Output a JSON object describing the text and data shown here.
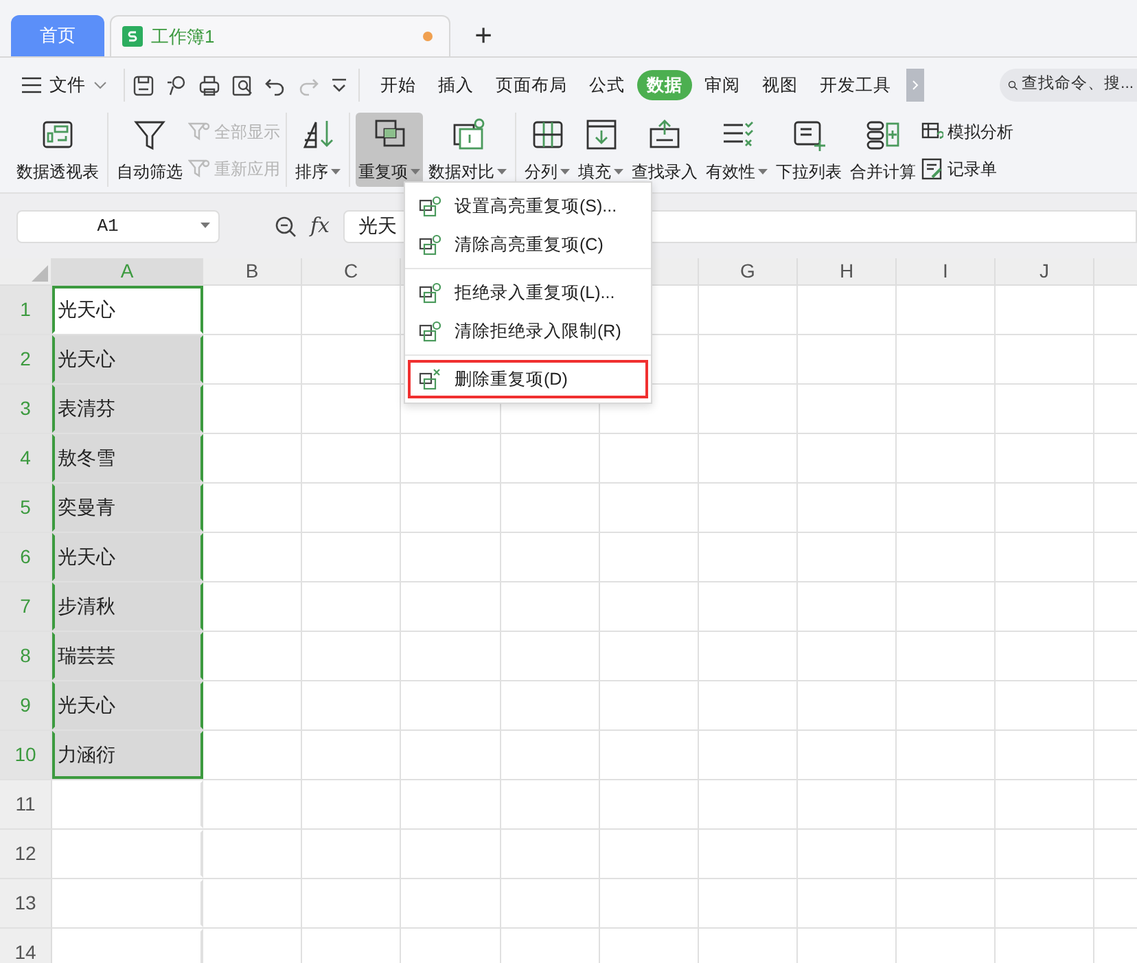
{
  "tabs": [
    {
      "kind": "home",
      "label": "首页",
      "selected": false
    },
    {
      "kind": "document",
      "label": "工作簿1",
      "selected": true,
      "modified": true
    }
  ],
  "new_tab": "+",
  "toolbar": {
    "menu": "文件",
    "ribbon_tabs": [
      {
        "label": "开始",
        "selected": false
      },
      {
        "label": "插入",
        "selected": false
      },
      {
        "label": "页面布局",
        "selected": false
      },
      {
        "label": "公式",
        "selected": false
      },
      {
        "label": "数据",
        "selected": true
      },
      {
        "label": "审阅",
        "selected": false
      },
      {
        "label": "视图",
        "selected": false
      },
      {
        "label": "开发工具",
        "selected": false
      }
    ],
    "search": {
      "placeholder": "查找命令、搜..."
    }
  },
  "ribbon": {
    "groups": [
      {
        "items": [
          {
            "kind": "large",
            "label": "数据透视表",
            "dropdown": false,
            "selected": false
          }
        ]
      },
      {
        "items": [
          {
            "kind": "large",
            "label": "自动筛选",
            "dropdown": false,
            "selected": false
          },
          {
            "kind": "stack",
            "buttons": [
              {
                "label": "全部显示",
                "disabled": true
              },
              {
                "label": "重新应用",
                "disabled": true
              }
            ]
          }
        ]
      },
      {
        "items": [
          {
            "kind": "large",
            "label": "排序",
            "dropdown": true,
            "selected": false
          }
        ]
      },
      {
        "items": [
          {
            "kind": "large",
            "label": "重复项",
            "dropdown": true,
            "selected": true
          },
          {
            "kind": "large",
            "label": "数据对比",
            "dropdown": true,
            "selected": false
          }
        ]
      },
      {
        "items": [
          {
            "kind": "large",
            "label": "分列",
            "dropdown": true,
            "selected": false
          },
          {
            "kind": "large",
            "label": "填充",
            "dropdown": true,
            "selected": false
          },
          {
            "kind": "large",
            "label": "查找录入",
            "dropdown": false,
            "selected": false
          },
          {
            "kind": "large",
            "label": "有效性",
            "dropdown": true,
            "selected": false
          },
          {
            "kind": "large",
            "label": "下拉列表",
            "dropdown": false,
            "selected": false
          },
          {
            "kind": "large",
            "label": "合并计算",
            "dropdown": false,
            "selected": false
          },
          {
            "kind": "stack",
            "buttons": [
              {
                "label": "模拟分析",
                "disabled": false
              },
              {
                "label": "记录单",
                "disabled": false
              }
            ]
          }
        ]
      }
    ]
  },
  "formula_bar": {
    "name_box": "A1",
    "fx": "fx",
    "value": "光天"
  },
  "sheet": {
    "columns": [
      {
        "label": "A",
        "selected": true
      },
      {
        "label": "B",
        "selected": false
      },
      {
        "label": "C",
        "selected": false
      },
      {
        "label": "G",
        "selected": false
      },
      {
        "label": "H",
        "selected": false
      },
      {
        "label": "I",
        "selected": false
      },
      {
        "label": "J",
        "selected": false
      }
    ],
    "rows": [
      {
        "number": "1",
        "selected": true,
        "active": true,
        "a": "光天心"
      },
      {
        "number": "2",
        "selected": true,
        "active": false,
        "a": "光天心"
      },
      {
        "number": "3",
        "selected": true,
        "active": false,
        "a": "表清芬"
      },
      {
        "number": "4",
        "selected": true,
        "active": false,
        "a": "敖冬雪"
      },
      {
        "number": "5",
        "selected": true,
        "active": false,
        "a": "奕曼青"
      },
      {
        "number": "6",
        "selected": true,
        "active": false,
        "a": "光天心"
      },
      {
        "number": "7",
        "selected": true,
        "active": false,
        "a": "步清秋"
      },
      {
        "number": "8",
        "selected": true,
        "active": false,
        "a": "瑞芸芸"
      },
      {
        "number": "9",
        "selected": true,
        "active": false,
        "a": "光天心"
      },
      {
        "number": "10",
        "selected": true,
        "active": false,
        "a": "力涵衍"
      },
      {
        "number": "11",
        "selected": false,
        "active": false
      },
      {
        "number": "12",
        "selected": false,
        "active": false
      },
      {
        "number": "13",
        "selected": false,
        "active": false
      },
      {
        "number": "14",
        "selected": false,
        "active": false
      }
    ]
  },
  "dropdown_menu": {
    "sections": [
      [
        {
          "label": "设置高亮重复项(S)...",
          "highlighted": false
        },
        {
          "label": "清除高亮重复项(C)",
          "highlighted": false
        }
      ],
      [
        {
          "label": "拒绝录入重复项(L)...",
          "highlighted": false
        },
        {
          "label": "清除拒绝录入限制(R)",
          "highlighted": false
        }
      ],
      [
        {
          "label": "删除重复项(D)",
          "highlighted": true
        }
      ]
    ]
  }
}
